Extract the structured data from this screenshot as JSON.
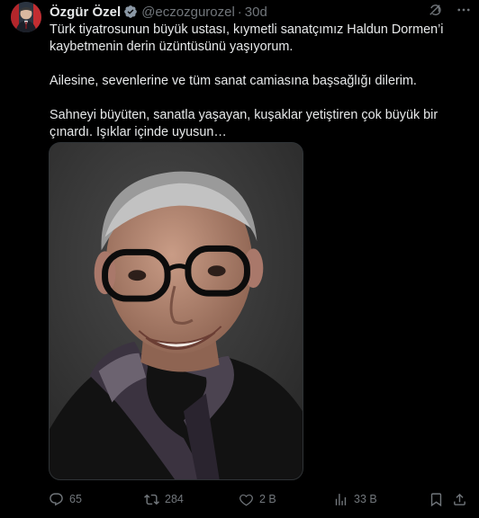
{
  "author": {
    "name": "Özgür Özel",
    "handle": "@eczozgurozel",
    "separator": "·",
    "time": "30d"
  },
  "tweet": {
    "paragraphs": [
      "Türk tiyatrosunun büyük ustası, kıymetli sanatçımız Haldun Dormen’i kaybetmenin derin üzüntüsünü yaşıyorum.",
      "Ailesine, sevenlerine ve tüm sanat camiasına başsağlığı dilerim.",
      "Sahneyi büyüten, sanatla yaşayan, kuşaklar yetiştiren çok büyük bir çınardı. Işıklar içinde uyusun…"
    ]
  },
  "actions": {
    "replies": "65",
    "reposts": "284",
    "likes": "2 B",
    "views": "33 B"
  },
  "icons": {
    "verified": "verified-badge-icon",
    "grok": "grok-icon",
    "more": "more-icon",
    "reply": "reply-icon",
    "repost": "repost-icon",
    "like": "heart-icon",
    "views": "views-icon",
    "bookmark": "bookmark-icon",
    "share": "share-icon"
  },
  "colors": {
    "background": "#000000",
    "text": "#e7e9ea",
    "muted": "#71767b",
    "verified": "#8b98a5"
  }
}
